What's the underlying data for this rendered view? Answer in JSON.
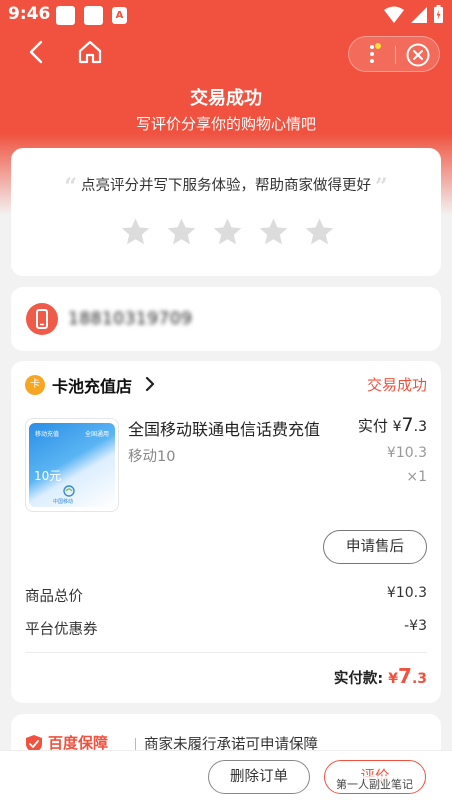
{
  "status_bar": {
    "time": "9:46",
    "notif_icon_c": "A"
  },
  "nav": {
    "back_icon": "chevron-left-icon",
    "home_icon": "home-icon",
    "more_icon": "more-vertical-icon",
    "close_icon": "close-circle-icon"
  },
  "header": {
    "title": "交易成功",
    "subtitle": "写评价分享你的购物心情吧"
  },
  "review": {
    "prompt": "点亮评分并写下服务体验，帮助商家做得更好",
    "stars": 5,
    "rating": 0
  },
  "contact": {
    "phone": "18810319709"
  },
  "order": {
    "shop_icon_text": "卡",
    "shop_name": "卡池充值店",
    "status": "交易成功",
    "product": {
      "card_text_left": "移动充值",
      "card_text_right": "全国通用",
      "card_value": "10元",
      "card_brand": "中国移动",
      "name": "全国移动联通电信话费充值",
      "spec": "移动10",
      "paid_label": "实付",
      "paid_currency": "¥",
      "paid_int": "7",
      "paid_dec": ".3",
      "original_price": "¥10.3",
      "quantity": "×1"
    },
    "after_sale_label": "申请售后",
    "summary": {
      "goods_total_label": "商品总价",
      "goods_total_value": "¥10.3",
      "coupon_label": "平台优惠券",
      "coupon_value": "-¥3",
      "total_label": "实付款:",
      "total_currency": "¥",
      "total_int": "7",
      "total_dec": ".3"
    }
  },
  "guarantee": {
    "brand": "百度保障",
    "text": "商家未履行承诺可申请保障"
  },
  "actions": {
    "delete_label": "删除订单",
    "review_label": "评价"
  },
  "watermark": "第一人副业笔记",
  "colors": {
    "accent": "#f0523f",
    "star_empty": "#dcdcdc"
  }
}
